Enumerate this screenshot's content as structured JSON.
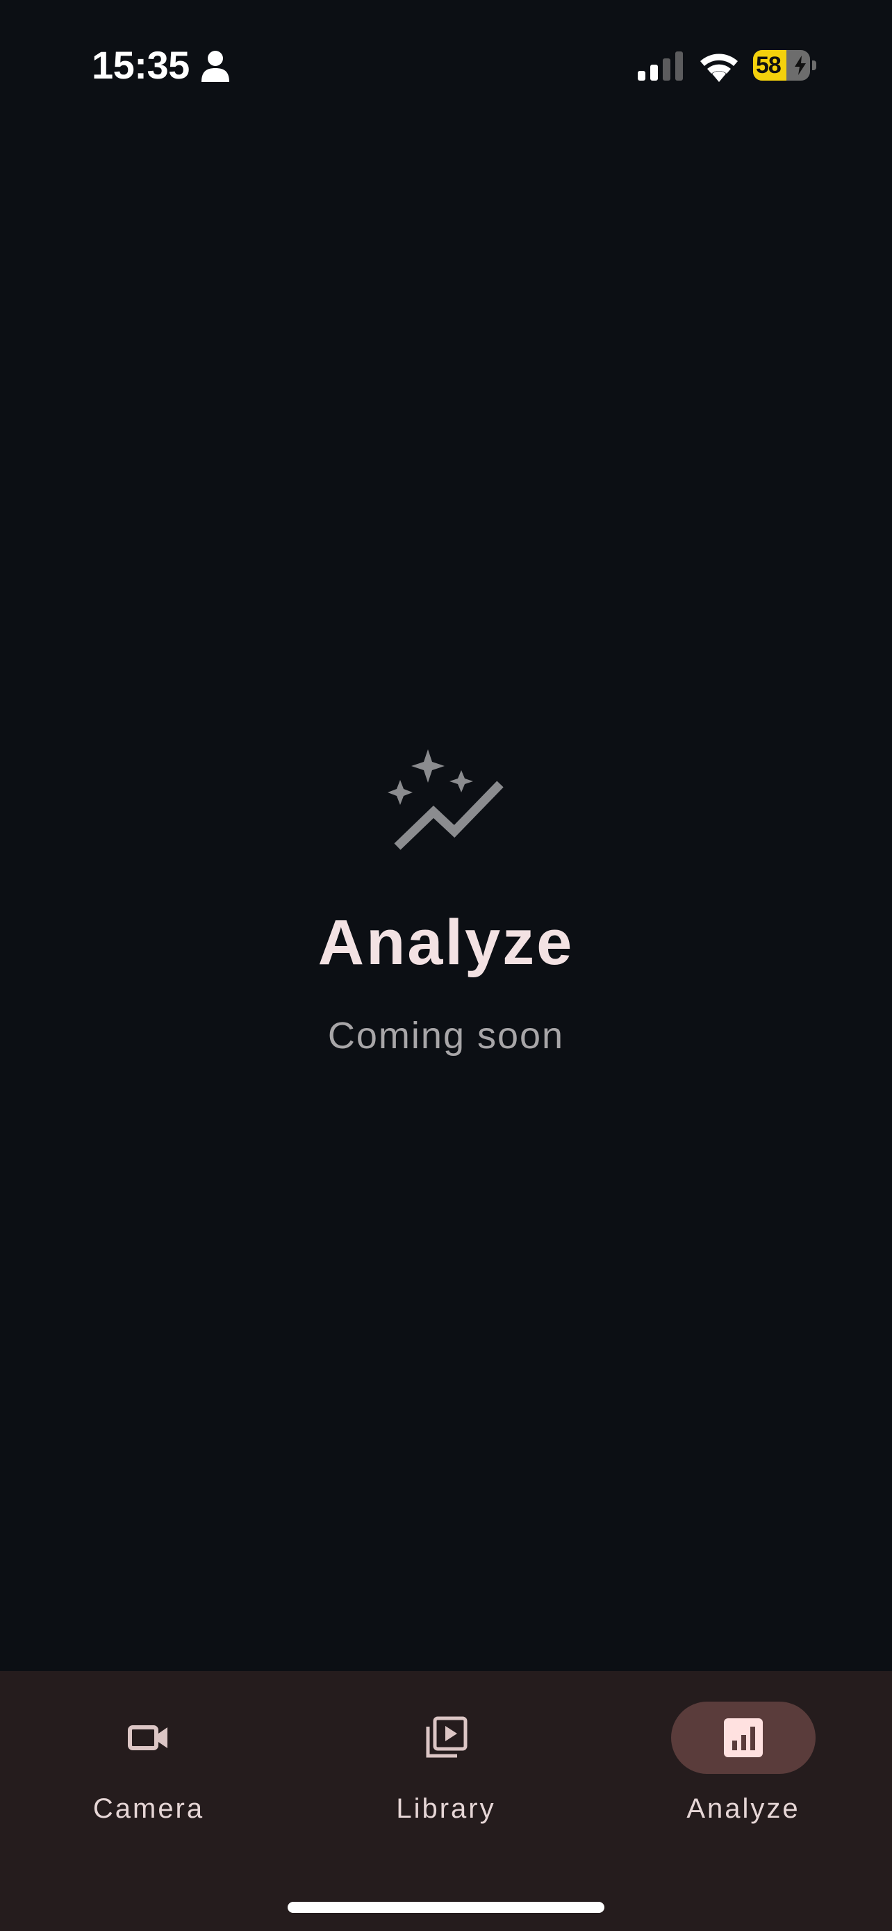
{
  "status_bar": {
    "time": "15:35",
    "battery_percent": 58,
    "battery_label": "58",
    "icons": [
      "person-icon",
      "cellular-signal-icon",
      "wifi-icon",
      "battery-icon",
      "charging-bolt-icon"
    ]
  },
  "main": {
    "icon": "sparkle-trend-icon",
    "title": "Analyze",
    "subtitle": "Coming soon"
  },
  "bottom_nav": {
    "items": [
      {
        "label": "Camera",
        "icon": "video-camera-icon",
        "active": false
      },
      {
        "label": "Library",
        "icon": "video-library-icon",
        "active": false
      },
      {
        "label": "Analyze",
        "icon": "bar-chart-icon",
        "active": true
      }
    ]
  },
  "colors": {
    "background": "#0c0f14",
    "nav_background": "#251c1d",
    "active_pill": "#5a3c3b",
    "title_text": "#f3e2e3",
    "subtitle_text": "#a8a6a8",
    "battery_fill": "#f4d10c"
  }
}
